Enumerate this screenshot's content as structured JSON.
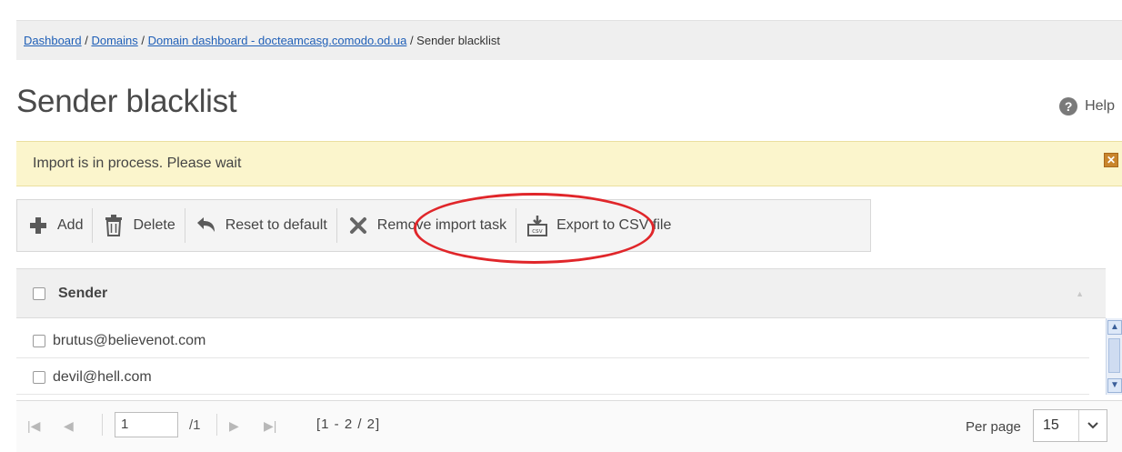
{
  "breadcrumb": {
    "items": [
      {
        "label": "Dashboard"
      },
      {
        "label": "Domains"
      },
      {
        "label": "Domain dashboard - docteamcasg.comodo.od.ua"
      }
    ],
    "current": "Sender blacklist",
    "separator": " / "
  },
  "page": {
    "title": "Sender blacklist",
    "help_label": "Help",
    "help_icon": "question-circle-icon"
  },
  "alert": {
    "message": "Import is in process. Please wait",
    "close_icon": "close-icon",
    "color": "#fbf5cc"
  },
  "toolbar": {
    "add_label": "Add",
    "delete_label": "Delete",
    "reset_label": "Reset to default",
    "remove_import_label": "Remove import task",
    "export_label": "Export to CSV file"
  },
  "grid": {
    "column_header": "Sender",
    "rows": [
      {
        "sender": "brutus@believenot.com"
      },
      {
        "sender": "devil@hell.com"
      }
    ]
  },
  "pager": {
    "page_value": "1",
    "total_pages": "/1",
    "range": "[1 - 2 / 2]",
    "per_page_label": "Per page",
    "per_page_value": "15"
  },
  "annotation": {
    "highlight_color": "#e0262a",
    "highlight_target": "remove-import-task-button"
  }
}
